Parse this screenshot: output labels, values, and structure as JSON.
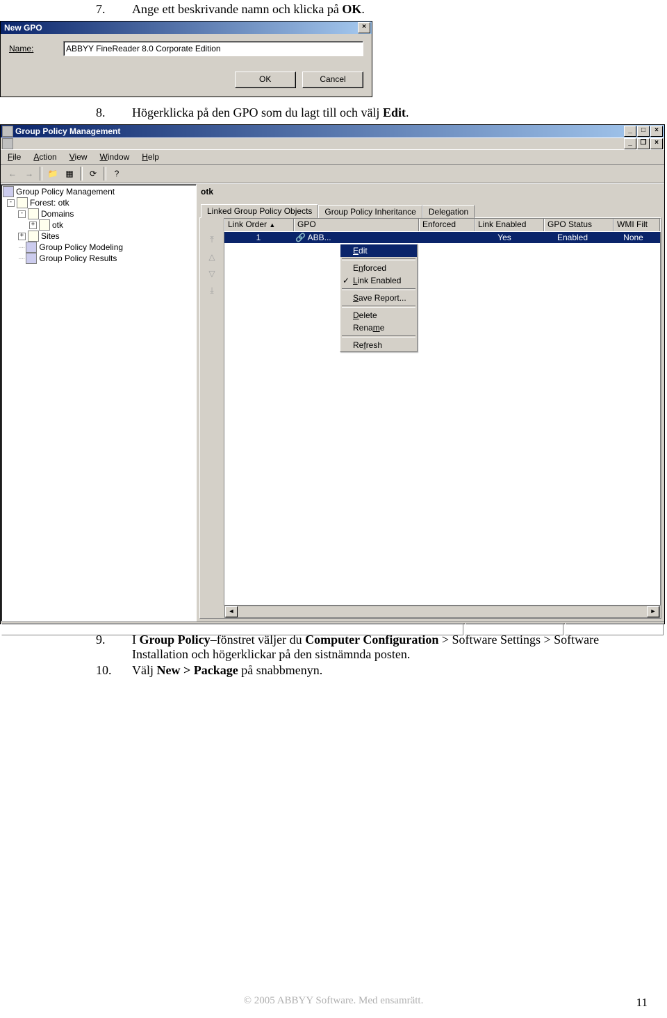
{
  "steps": {
    "s7": {
      "num": "7.",
      "text_a": "Ange ett beskrivande namn och klicka på ",
      "text_b": "OK",
      "text_c": "."
    },
    "s8": {
      "num": "8.",
      "text_a": "Högerklicka på den GPO som du lagt till och välj ",
      "text_b": "Edit",
      "text_c": "."
    },
    "s9": {
      "num": "9.",
      "text_a": "I ",
      "text_b": "Group Policy",
      "text_c": "–fönstret väljer du ",
      "text_d": "Computer Configuration",
      "text_e": " > Software Settings > Software Installation och högerklickar på den sistnämnda posten."
    },
    "s10": {
      "num": "10.",
      "text_a": "Välj ",
      "text_b": "New > Package",
      "text_c": " på snabbmenyn."
    }
  },
  "dialog": {
    "title": "New GPO",
    "name_label": "Name:",
    "name_value": "ABBYY FineReader 8.0 Corporate Edition",
    "ok": "OK",
    "cancel": "Cancel"
  },
  "gpm": {
    "title": "Group Policy Management",
    "menu": {
      "file": "File",
      "action": "Action",
      "view": "View",
      "window": "Window",
      "help": "Help"
    },
    "tree": {
      "root": "Group Policy Management",
      "forest": "Forest: otk",
      "domains": "Domains",
      "otk": "otk",
      "sites": "Sites",
      "gpm": "Group Policy Modeling",
      "gpr": "Group Policy Results"
    },
    "right_header": "otk",
    "tabs": {
      "linked": "Linked Group Policy Objects",
      "inh": "Group Policy Inheritance",
      "del": "Delegation"
    },
    "grid": {
      "cols": {
        "lo": "Link Order",
        "gpo": "GPO",
        "enf": "Enforced",
        "le": "Link Enabled",
        "status": "GPO Status",
        "wmi": "WMI Filt"
      },
      "row": {
        "lo": "1",
        "gpo": "ABB...",
        "enf": "",
        "le": "Yes",
        "status": "Enabled",
        "wmi": "None"
      }
    },
    "ctx": {
      "edit": "Edit",
      "enforced": "Enforced",
      "linken": "Link Enabled",
      "save": "Save Report...",
      "delete": "Delete",
      "rename": "Rename",
      "refresh": "Refresh"
    }
  },
  "footer": "© 2005 ABBYY Software. Med ensamrätt.",
  "page": "11"
}
